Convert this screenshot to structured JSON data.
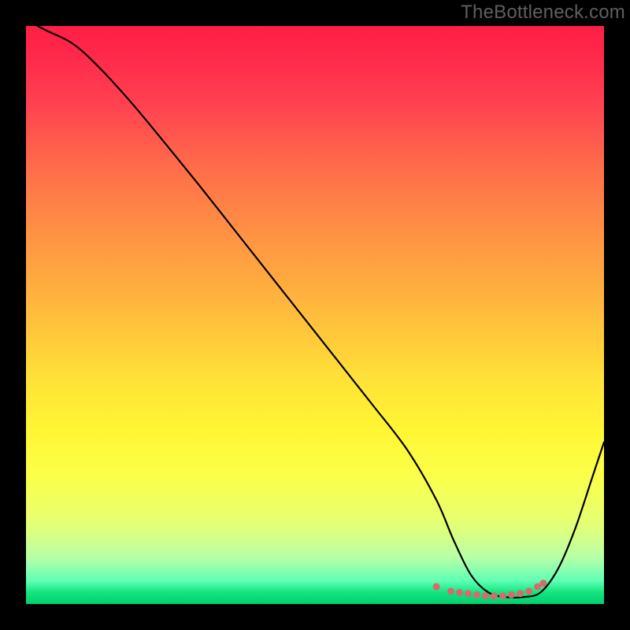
{
  "watermark": {
    "text": "TheBottleneck.com"
  },
  "chart_data": {
    "type": "line",
    "title": "",
    "xlabel": "",
    "ylabel": "",
    "xlim": [
      0,
      100
    ],
    "ylim": [
      0,
      100
    ],
    "grid": false,
    "series": [
      {
        "name": "bottleneck-curve",
        "x": [
          2,
          4,
          8,
          12,
          18,
          24,
          30,
          36,
          42,
          48,
          54,
          60,
          66,
          71,
          74,
          77,
          80,
          83,
          86,
          89,
          92,
          95,
          98,
          100
        ],
        "y": [
          100,
          99,
          97,
          93.5,
          87,
          79.8,
          72.4,
          64.8,
          57.2,
          49.6,
          42,
          34.4,
          26.6,
          18,
          11,
          5,
          2,
          1.2,
          1.2,
          2,
          6,
          13,
          22,
          28
        ]
      }
    ],
    "highlight": {
      "name": "bottom-dots",
      "points_x": [
        71,
        73.5,
        75,
        76.5,
        78,
        79.5,
        81,
        82.5,
        84,
        85.5,
        87,
        88.5,
        89.5
      ],
      "points_y": [
        3.0,
        2.2,
        2.0,
        1.8,
        1.6,
        1.4,
        1.4,
        1.4,
        1.6,
        1.8,
        2.2,
        3.0,
        3.6
      ],
      "color": "#d86a6b",
      "radius": 4.5
    },
    "gradient_stops": [
      {
        "pct": 0,
        "color": "#ff1e46"
      },
      {
        "pct": 6,
        "color": "#ff2b4b"
      },
      {
        "pct": 14,
        "color": "#ff4350"
      },
      {
        "pct": 24,
        "color": "#ff6b4a"
      },
      {
        "pct": 34,
        "color": "#ff8c45"
      },
      {
        "pct": 44,
        "color": "#ffaa3f"
      },
      {
        "pct": 54,
        "color": "#ffca3a"
      },
      {
        "pct": 62,
        "color": "#ffe437"
      },
      {
        "pct": 70,
        "color": "#fff634"
      },
      {
        "pct": 78,
        "color": "#fbff4a"
      },
      {
        "pct": 86,
        "color": "#e6ff73"
      },
      {
        "pct": 92,
        "color": "#b7ffa8"
      },
      {
        "pct": 96,
        "color": "#5effb4"
      },
      {
        "pct": 98,
        "color": "#13e57e"
      },
      {
        "pct": 100,
        "color": "#00cf6f"
      }
    ]
  }
}
